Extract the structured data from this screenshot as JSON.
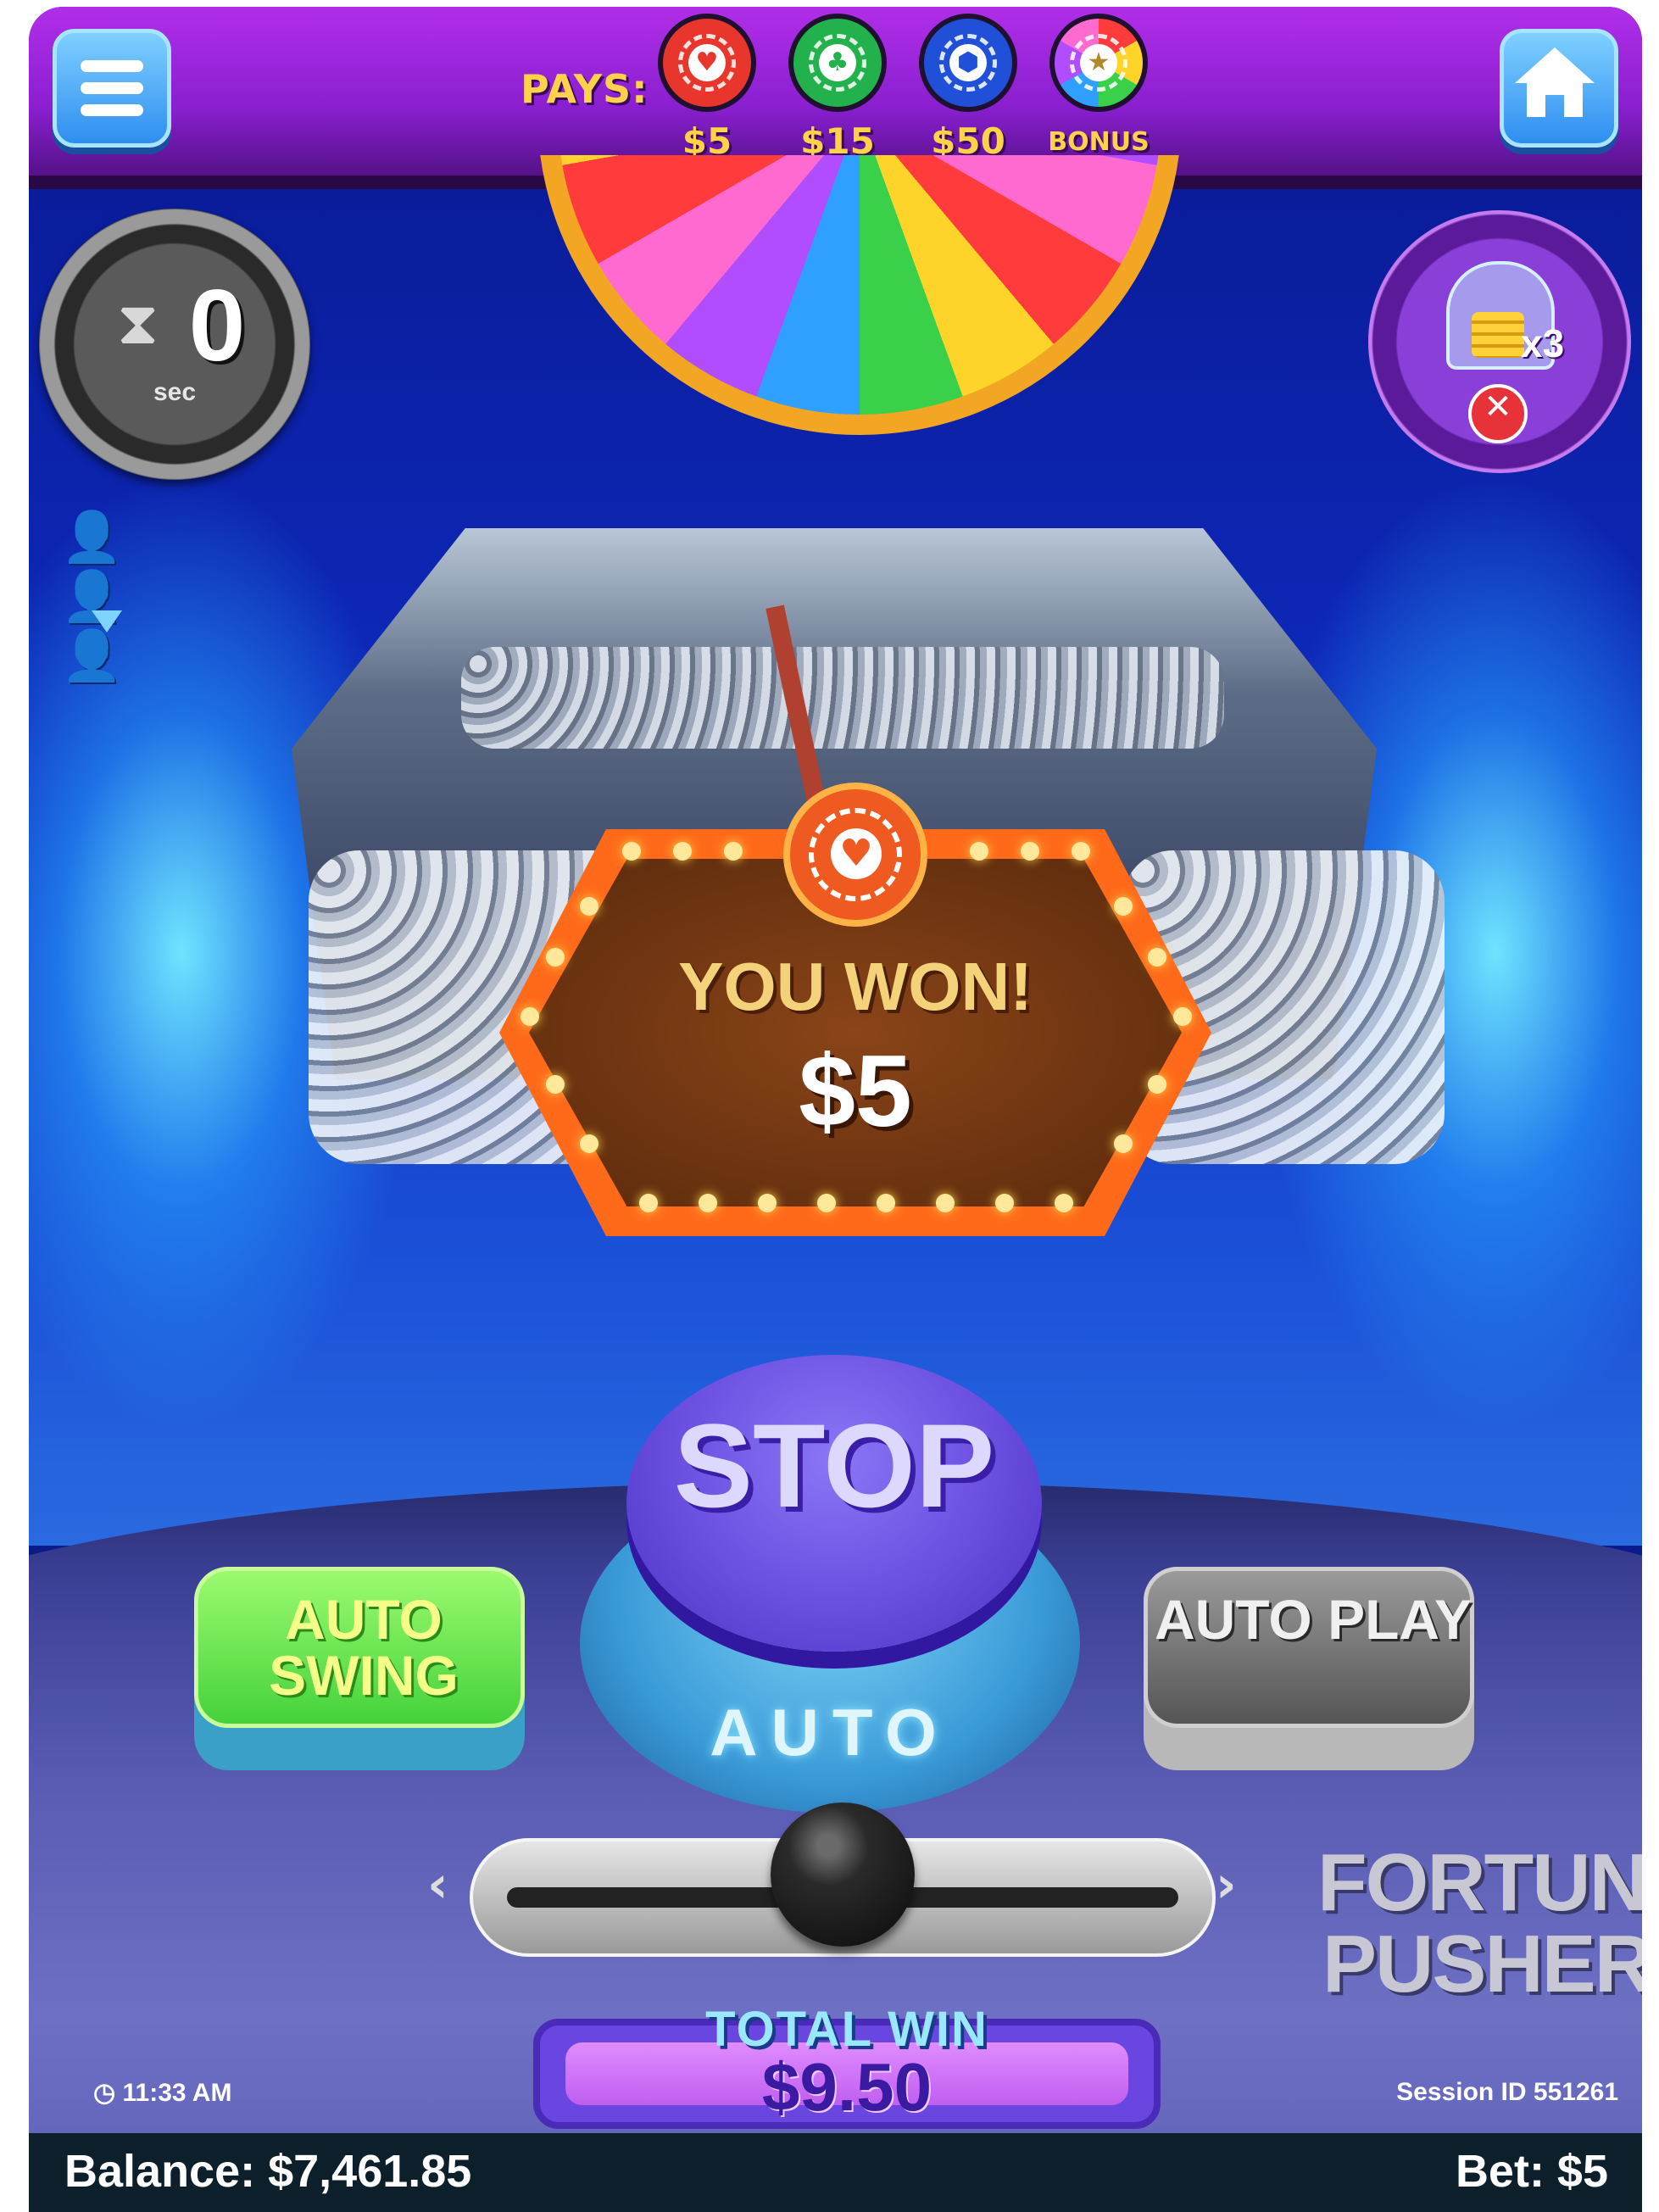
{
  "header": {
    "pays_label": "PAYS:",
    "payouts": [
      {
        "icon": "heart",
        "label": "$5",
        "color": "#e8362c"
      },
      {
        "icon": "club",
        "label": "$15",
        "color": "#22b14c"
      },
      {
        "icon": "hexagon",
        "label": "$50",
        "color": "#2050d8"
      },
      {
        "icon": "star",
        "label": "BONUS",
        "color": "#ff7a2a"
      }
    ]
  },
  "timer": {
    "value": "0",
    "unit": "sec"
  },
  "coin_boost": {
    "multiplier": "x3"
  },
  "win_popup": {
    "title": "YOU WON!",
    "amount": "$5"
  },
  "controls": {
    "stop_label": "STOP",
    "auto_label": "AUTO",
    "auto_swing_label": "AUTO SWING",
    "auto_play_label": "AUTO PLAY",
    "pusher_slider_position": 0.5
  },
  "brand": {
    "line1": "FORTUNE",
    "line2": "PUSHER"
  },
  "total_win": {
    "label": "TOTAL WIN",
    "value": "$9.50"
  },
  "status": {
    "time": "11:33 AM",
    "session": "Session ID 551261"
  },
  "footer": {
    "balance": "Balance: $7,461.85",
    "bet": "Bet: $5"
  },
  "colors": {
    "accent": "#8a1fd0",
    "stop_button": "#6a4ee0",
    "auto_swing": "#44d23a"
  }
}
